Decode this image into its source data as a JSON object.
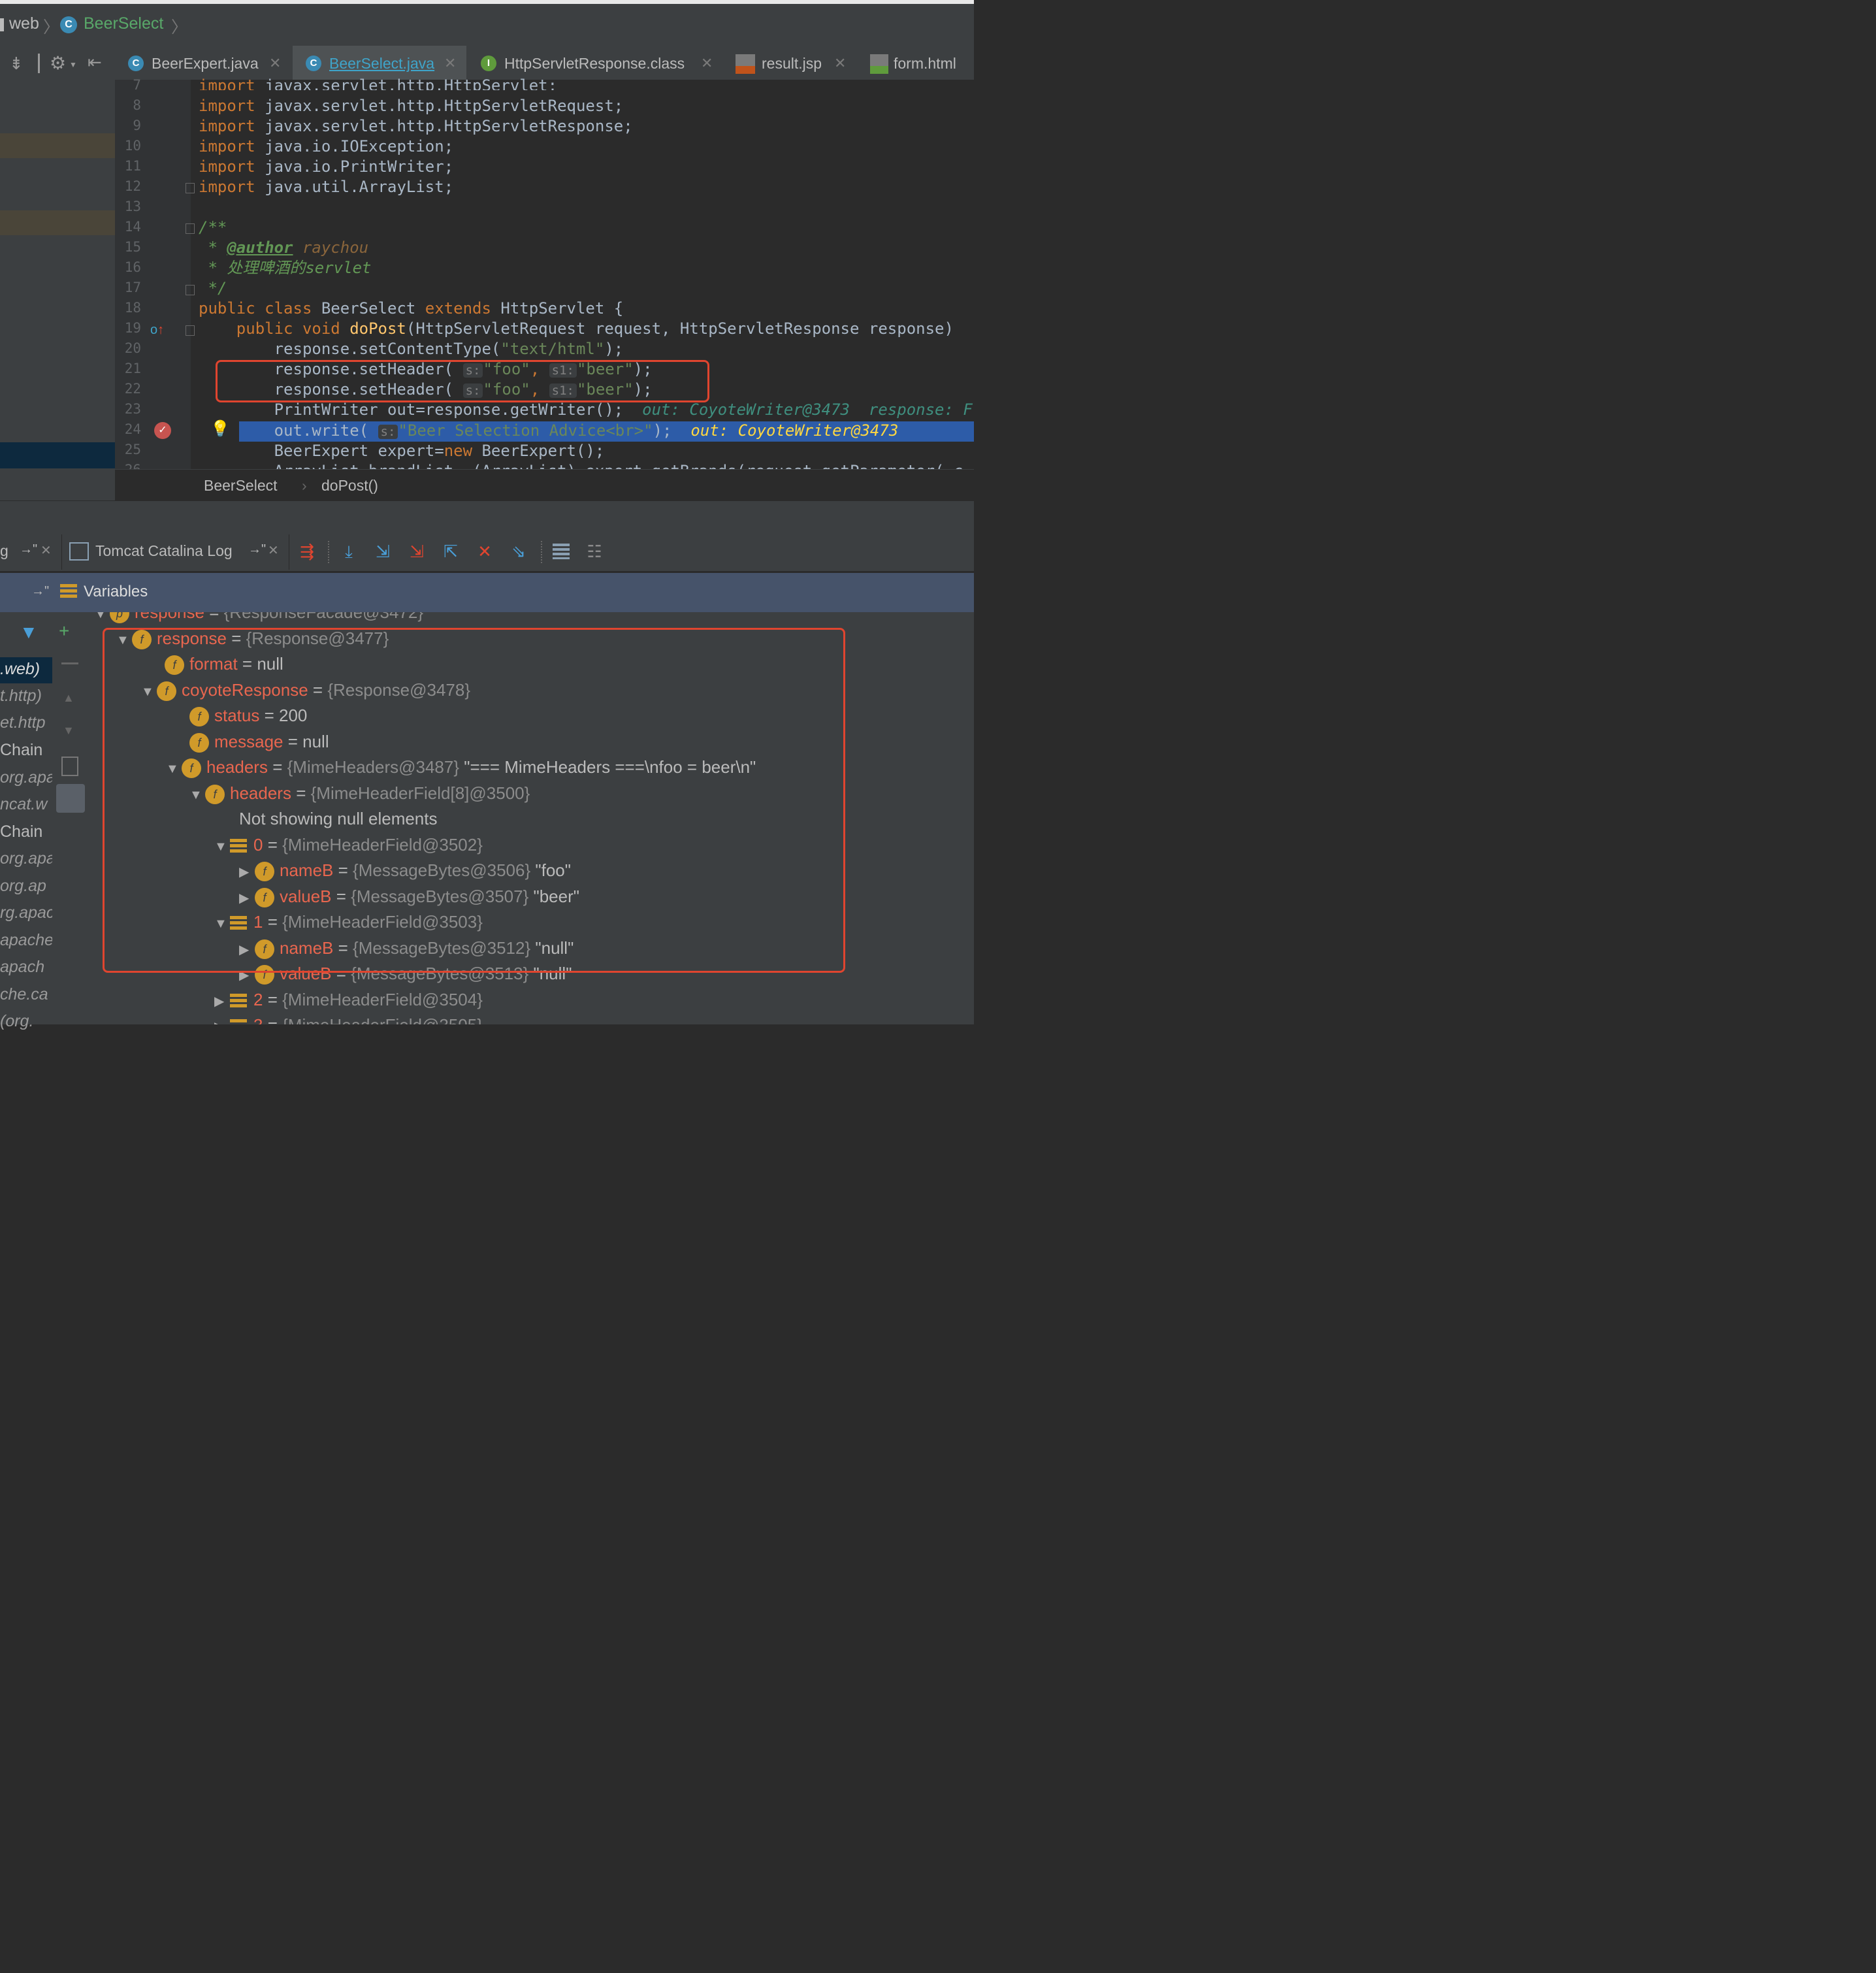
{
  "navbar": {
    "module": "web",
    "class_name": "BeerSelect"
  },
  "editor_tabs": [
    {
      "label": "BeerExpert.java",
      "icon": "class-icon",
      "active": false
    },
    {
      "label": "BeerSelect.java",
      "icon": "class-icon",
      "active": true
    },
    {
      "label": "HttpServletResponse.class",
      "icon": "interface-icon",
      "active": false
    },
    {
      "label": "result.jsp",
      "icon": "jsp-icon",
      "active": false
    },
    {
      "label": "form.html",
      "icon": "html-icon",
      "active": false
    }
  ],
  "code": {
    "line_numbers": [
      "7",
      "8",
      "9",
      "10",
      "11",
      "12",
      "13",
      "14",
      "15",
      "16",
      "17",
      "18",
      "19",
      "20",
      "21",
      "22",
      "23",
      "24",
      "25",
      "26"
    ],
    "l7": "import javax.servlet.http.HttpServlet;",
    "l8_pkg": "javax.servlet.http.HttpServletRequest;",
    "l9_pkg": "javax.servlet.http.HttpServletResponse;",
    "l10_pkg": "java.io.IOException;",
    "l11_pkg": "java.io.PrintWriter;",
    "l12_pkg": "java.util.ArrayList;",
    "kw_import": "import",
    "l14": "/**",
    "l15_star": " * ",
    "l15_tag": "@author",
    "l15_val": " raychou",
    "l16": " * 处理啤酒的servlet",
    "l17": " */",
    "l18_a": "public class ",
    "l18_b": "BeerSelect ",
    "l18_c": "extends ",
    "l18_d": "HttpServlet {",
    "l19_a": "    public void ",
    "l19_b": "doPost",
    "l19_c": "(HttpServletRequest request, HttpServletResponse response) ",
    "l20_a": "        response.setContentType(",
    "l20_b": "\"text/html\"",
    "l20_c": ");",
    "set_header": "        response.setHeader( ",
    "hint_s": "s:",
    "hint_s1": "s1:",
    "str_foo": "\"foo\"",
    "str_beer": "\"beer\"",
    "comma": ", ",
    "close": ");",
    "l23": "        PrintWriter out=response.getWriter();",
    "l23_inline": "  out: CoyoteWriter@3473  response: F",
    "l24_a": "        out.write( ",
    "l24_str": "\"Beer Selection Advice<br>\"",
    "l24_inline": "  out: CoyoteWriter@3473",
    "l25_a": "        BeerExpert expert=",
    "l25_new": "new ",
    "l25_b": "BeerExpert();",
    "l26": "        ArrayList brandList  (ArrayList) expert getBrands(request getParameter( c"
  },
  "breadcrumb": {
    "class": "BeerSelect",
    "method": "doPost()"
  },
  "debug_tabs": [
    {
      "label": "g",
      "pin": "→\""
    },
    {
      "label": "Tomcat Catalina Log",
      "pin": "→\""
    }
  ],
  "variables_title": "Variables",
  "frames": [
    ".web)",
    "t.http)",
    "et.http",
    "Chain",
    "org.apa",
    "ncat.w",
    "Chain",
    "org.apa",
    "org.ap",
    "rg.apac",
    "apache",
    "apach",
    "che.ca",
    "(org."
  ],
  "variables": [
    {
      "indent": 0,
      "arrow": "▼",
      "icon": "p",
      "name": "response",
      "eq": " = ",
      "ref": "{ResponseFacade@3472}",
      "extra": ""
    },
    {
      "indent": 1,
      "arrow": "▼",
      "icon": "f",
      "name": "response",
      "eq": " = ",
      "ref": "{Response@3477}",
      "extra": ""
    },
    {
      "indent": 2,
      "arrow": "",
      "icon": "f",
      "name": "format",
      "eq": " = ",
      "ref": "",
      "extra": "null"
    },
    {
      "indent": 2,
      "arrow": "▼",
      "icon": "f",
      "name": "coyoteResponse",
      "eq": " = ",
      "ref": "{Response@3478}",
      "extra": ""
    },
    {
      "indent": 3,
      "arrow": "",
      "icon": "f",
      "name": "status",
      "eq": " = ",
      "ref": "",
      "extra": "200"
    },
    {
      "indent": 3,
      "arrow": "",
      "icon": "f",
      "name": "message",
      "eq": " = ",
      "ref": "",
      "extra": "null"
    },
    {
      "indent": 3,
      "arrow": "▼",
      "icon": "f",
      "name": "headers",
      "eq": " = ",
      "ref": "{MimeHeaders@3487}",
      "extra": " \"=== MimeHeaders ===\\nfoo = beer\\n\""
    },
    {
      "indent": 4,
      "arrow": "▼",
      "icon": "f",
      "name": "headers",
      "eq": " = ",
      "ref": "{MimeHeaderField[8]@3500}",
      "extra": ""
    },
    {
      "indent": 5,
      "arrow": "",
      "icon": "",
      "name": "",
      "eq": "",
      "ref": "",
      "extra": "Not showing null elements"
    },
    {
      "indent": 5,
      "arrow": "▼",
      "icon": "a",
      "name": "0",
      "eq": " = ",
      "ref": "{MimeHeaderField@3502}",
      "extra": ""
    },
    {
      "indent": 6,
      "arrow": "▶",
      "icon": "f",
      "name": "nameB",
      "eq": " = ",
      "ref": "{MessageBytes@3506}",
      "extra": " \"foo\""
    },
    {
      "indent": 6,
      "arrow": "▶",
      "icon": "f",
      "name": "valueB",
      "eq": " = ",
      "ref": "{MessageBytes@3507}",
      "extra": " \"beer\""
    },
    {
      "indent": 5,
      "arrow": "▼",
      "icon": "a",
      "name": "1",
      "eq": " = ",
      "ref": "{MimeHeaderField@3503}",
      "extra": ""
    },
    {
      "indent": 6,
      "arrow": "▶",
      "icon": "f",
      "name": "nameB",
      "eq": " = ",
      "ref": "{MessageBytes@3512}",
      "extra": " \"null\""
    },
    {
      "indent": 6,
      "arrow": "▶",
      "icon": "f",
      "name": "valueB",
      "eq": " = ",
      "ref": "{MessageBytes@3513}",
      "extra": " \"null\""
    },
    {
      "indent": 5,
      "arrow": "▶",
      "icon": "a",
      "name": "2",
      "eq": " = ",
      "ref": "{MimeHeaderField@3504}",
      "extra": ""
    },
    {
      "indent": 5,
      "arrow": "▶",
      "icon": "a",
      "name": "3",
      "eq": " = ",
      "ref": "{MimeHeaderField@3505}",
      "extra": ""
    }
  ],
  "colors": {
    "highlight_line": "#2d5ca8",
    "annotation_box": "#e0452f",
    "field_icon": "#d09a2a"
  }
}
